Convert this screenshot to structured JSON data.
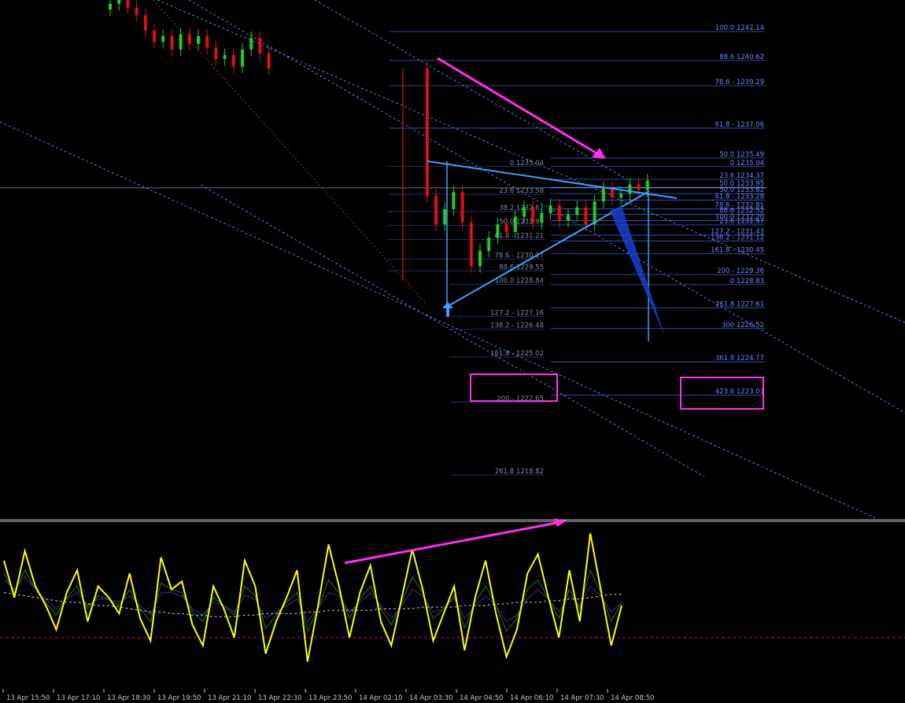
{
  "colors": {
    "background": "#000000",
    "fib_line": "#3a5fcd",
    "fib_text": "#6f86ff",
    "fib_text_gray": "#7a8aa0",
    "channel": "#4a90ff",
    "triangle": "#3ea0ff",
    "annotation": "#ff2ef0",
    "candle_up": "#22cc22",
    "candle_down": "#e01010",
    "osc_main": "#ffff00",
    "osc_signal1": "#1f7a1f",
    "osc_signal2": "#4b2a9a",
    "osc_ma": "#c8c8c8",
    "osc_level": "#b01070",
    "separator": "#c0c0c0",
    "axis_text": "#c8c8c8"
  },
  "chart_data": [
    {
      "type": "candlestick",
      "panel": "price",
      "y_range": [
        1216.5,
        1243.8
      ],
      "price_line": 1233.92,
      "fib_main_right": [
        {
          "label": "100.0 1242.14",
          "value": 1242.14
        },
        {
          "label": "88.6 1240.62",
          "value": 1240.62
        },
        {
          "label": "78.6 - 1239.29",
          "value": 1239.29
        },
        {
          "label": "61.8 - 1237.06",
          "value": 1237.06
        },
        {
          "label": "50.0 1235.49",
          "value": 1235.49
        },
        {
          "label": "0 1235.04",
          "value": 1235.04
        },
        {
          "label": "23.6 1234.37",
          "value": 1234.37
        },
        {
          "label": "50.0 1233.95",
          "value": 1233.95
        },
        {
          "label": "50.0 1233.62",
          "value": 1233.62
        },
        {
          "label": "61.8 - 1233.28",
          "value": 1233.28
        },
        {
          "label": "78.6 - 1232.81",
          "value": 1232.81
        },
        {
          "label": "88.6 1232.52",
          "value": 1232.52
        },
        {
          "label": "100.0 1232.20",
          "value": 1232.2
        },
        {
          "label": "23.6 1231.97",
          "value": 1231.97
        },
        {
          "label": "127.2 - 1231.43",
          "value": 1231.43
        },
        {
          "label": "136.2 - 1231.12",
          "value": 1231.12
        },
        {
          "label": "161.8 - 1230.45",
          "value": 1230.45
        },
        {
          "label": "200 - 1229.36",
          "value": 1229.36
        },
        {
          "label": "0 1228.83",
          "value": 1228.83
        },
        {
          "label": "261.8 1227.61",
          "value": 1227.61
        },
        {
          "label": "300 1226.52",
          "value": 1226.52
        },
        {
          "label": "361.8 1224.77",
          "value": 1224.77
        },
        {
          "label": "423.6 1223.01",
          "value": 1223.01
        }
      ],
      "fib_inner_labels": [
        {
          "label": "0 1235.04",
          "value": 1235.04
        },
        {
          "label": "23.6 1233.58",
          "value": 1233.58
        },
        {
          "label": "38.2 1232.67",
          "value": 1232.67
        },
        {
          "label": "50.0 1231.94",
          "value": 1231.94
        },
        {
          "label": "61.8 - 1231.21",
          "value": 1231.21
        },
        {
          "label": "78.6 - 1230.17",
          "value": 1230.17
        },
        {
          "label": "88.6 1229.55",
          "value": 1229.55
        },
        {
          "label": "100.0 1228.84",
          "value": 1228.84
        },
        {
          "label": "127.2 - 1227.16",
          "value": 1227.16
        },
        {
          "label": "138.2 - 1226.48",
          "value": 1226.48
        },
        {
          "label": "161.8 - 1225.02",
          "value": 1225.02
        },
        {
          "label": "200 - 1222.65",
          "value": 1222.65
        },
        {
          "label": "261.8 1218.82",
          "value": 1218.82
        }
      ],
      "highlighted_levels": [
        "161.8 - 1225.02",
        "361.8 1224.77"
      ],
      "close_path": [
        1243.6,
        1244.1,
        1243.4,
        1243.0,
        1242.2,
        1241.6,
        1241.9,
        1241.2,
        1242.0,
        1241.5,
        1241.9,
        1241.3,
        1240.7,
        1240.9,
        1240.3,
        1241.2,
        1241.8,
        1241.0,
        1240.2,
        1233.5,
        1232.0,
        1232.8,
        1233.7,
        1232.1,
        1229.8,
        1230.6,
        1231.3,
        1232.0,
        1231.6,
        1232.4,
        1232.9,
        1232.1,
        1232.6,
        1233.0,
        1232.2,
        1232.5,
        1232.9,
        1232.0,
        1233.2,
        1233.9,
        1233.4,
        1233.6,
        1234.1,
        1233.8,
        1234.3
      ]
    },
    {
      "type": "line",
      "panel": "oscillator",
      "y_range": [
        0,
        100
      ],
      "level": 30,
      "series": [
        {
          "values": [
            78,
            55,
            84,
            62,
            50,
            35,
            58,
            72,
            40,
            62,
            55,
            45,
            70,
            42,
            28,
            80,
            60,
            65,
            38,
            25,
            62,
            48,
            30,
            78,
            62,
            20,
            40,
            55,
            72,
            15,
            50,
            88,
            62,
            30,
            58,
            75,
            40,
            25,
            55,
            85,
            60,
            28,
            45,
            62,
            22,
            55,
            78,
            45,
            18,
            35,
            70,
            82,
            55,
            30,
            72,
            40,
            95,
            60,
            25,
            50
          ]
        },
        {
          "values": [
            70,
            58,
            72,
            60,
            52,
            44,
            55,
            62,
            48,
            56,
            54,
            50,
            60,
            48,
            40,
            64,
            60,
            58,
            46,
            40,
            55,
            50,
            44,
            62,
            56,
            36,
            44,
            52,
            58,
            34,
            48,
            66,
            58,
            42,
            54,
            62,
            48,
            38,
            52,
            68,
            58,
            42,
            48,
            56,
            36,
            52,
            62,
            50,
            34,
            42,
            60,
            66,
            54,
            42,
            60,
            48,
            72,
            58,
            40,
            52
          ]
        },
        {
          "values": [
            66,
            60,
            68,
            60,
            54,
            48,
            54,
            58,
            50,
            54,
            54,
            52,
            56,
            50,
            44,
            58,
            58,
            56,
            48,
            44,
            52,
            50,
            46,
            56,
            54,
            42,
            46,
            50,
            54,
            40,
            48,
            58,
            56,
            46,
            52,
            58,
            50,
            42,
            50,
            60,
            56,
            46,
            48,
            54,
            42,
            50,
            56,
            50,
            40,
            44,
            54,
            60,
            54,
            46,
            56,
            50,
            62,
            56,
            46,
            52
          ]
        },
        {
          "values": [
            58,
            57,
            56,
            55,
            54,
            53,
            52,
            52,
            51,
            50,
            50,
            49,
            48,
            47,
            46,
            46,
            45,
            45,
            44,
            44,
            43,
            43,
            43,
            44,
            44,
            45,
            45,
            45,
            45,
            46,
            46,
            47,
            47,
            47,
            47,
            47,
            48,
            48,
            48,
            48,
            49,
            49,
            49,
            49,
            50,
            50,
            50,
            51,
            51,
            52,
            52,
            52,
            53,
            53,
            54,
            54,
            55,
            56,
            57,
            57
          ]
        }
      ]
    }
  ],
  "time_axis": {
    "labels": [
      "13 Apr 15:50",
      "13 Apr 17:10",
      "13 Apr 18:30",
      "13 Apr 19:50",
      "13 Apr 21:10",
      "13 Apr 22:30",
      "13 Apr 23:50",
      "14 Apr 02:10",
      "14 Apr 03:30",
      "14 Apr 04:50",
      "14 Apr 06:10",
      "14 Apr 07:30",
      "14 Apr 08:50"
    ]
  }
}
